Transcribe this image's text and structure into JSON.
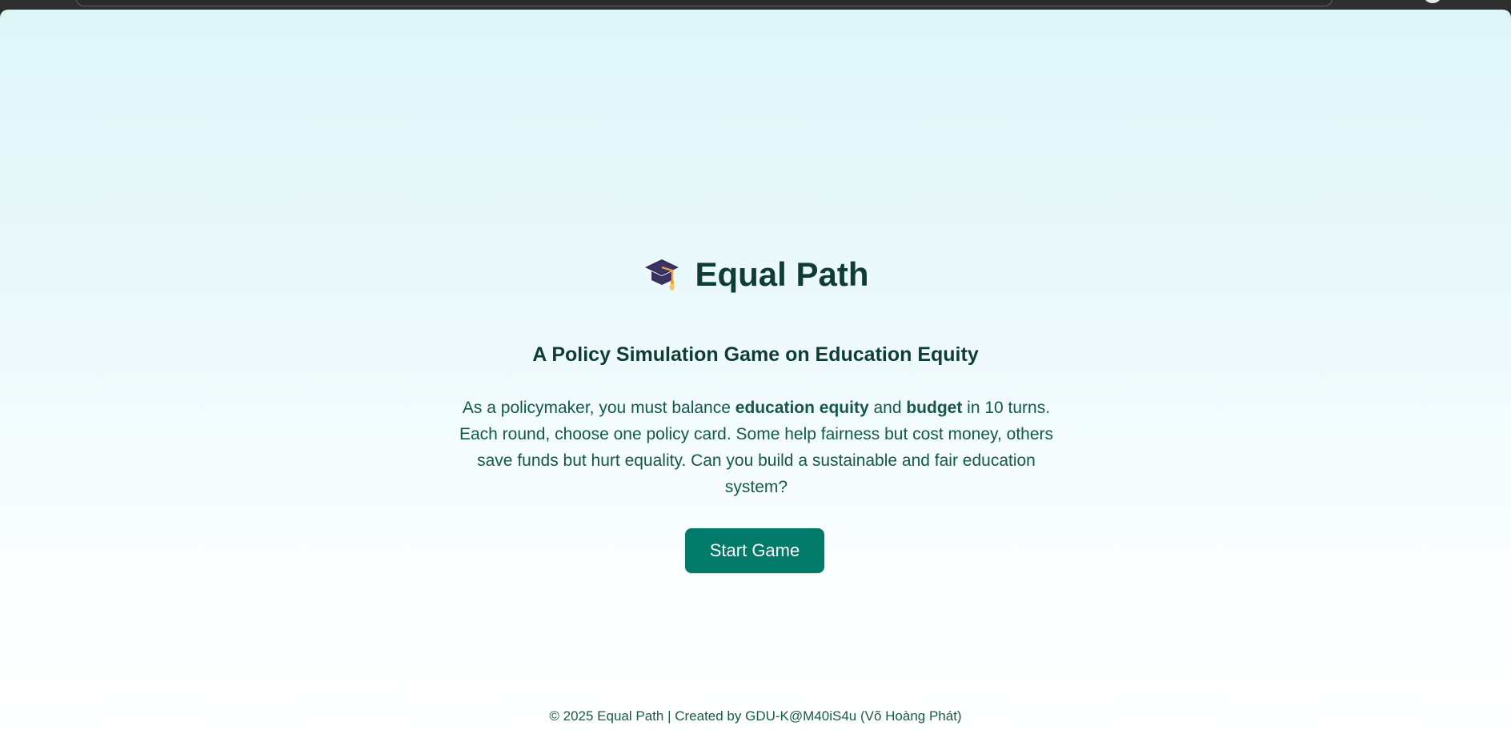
{
  "page": {
    "title": "Equal Path",
    "subtitle": "A Policy Simulation Game on Education Equity",
    "description": {
      "text_1": "As a policymaker, you must balance ",
      "bold_1": "education equity",
      "text_2": " and ",
      "bold_2": "budget",
      "text_3": " in 10 turns. Each round, choose one policy card. Some help fairness but cost money, others save funds but hurt equality. Can you build a sustainable and fair education system?"
    },
    "button": {
      "label": "Start Game"
    },
    "footer": "© 2025 Equal Path | Created by GDU-K@M40iS4u (Võ Hoàng Phát)"
  },
  "icons": {
    "title_icon": "graduation-cap-icon",
    "browser_profile_icon": "profile-icon"
  },
  "colors": {
    "accent": "#027a6a",
    "text_dark": "#0f3d35",
    "text_body": "#14584a",
    "background_top": "#def5f8",
    "background_bottom": "#ffffff"
  }
}
